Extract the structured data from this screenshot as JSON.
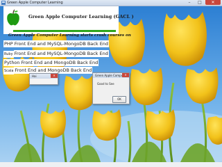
{
  "window": {
    "title": "Green Apple Computer Learning",
    "minimize": "–",
    "maximize": "□",
    "close": "✕"
  },
  "banner": {
    "title": "Green Apple Computer Learning (GACL )",
    "logo_icon": "green-apple-logo"
  },
  "tagline": "Green Apple Computer Learning starts crash courses on",
  "courses": [
    {
      "prefix": "PHP",
      "text": "Front End and MySQL-MongoDB Back End"
    },
    {
      "prefix": "Ruby",
      "text": "Front End and MySQL-MongoDB Back End"
    },
    {
      "prefix": "Python",
      "text": "Front End and MongoDB Back End"
    },
    {
      "prefix": "Scala",
      "text": "Front End and MongoDB Back End"
    }
  ],
  "dialog_small": {
    "title": "Hai",
    "close": "✕"
  },
  "dialog_message": {
    "title": "Green Apple Computer Learn...",
    "message": "Good to See",
    "ok": "OK",
    "close": "✕"
  },
  "colors": {
    "accent_green": "#2fa51d",
    "close_red": "#c9473c",
    "sky_blue": "#3d8fd8",
    "tulip_yellow": "#f2c21a"
  }
}
